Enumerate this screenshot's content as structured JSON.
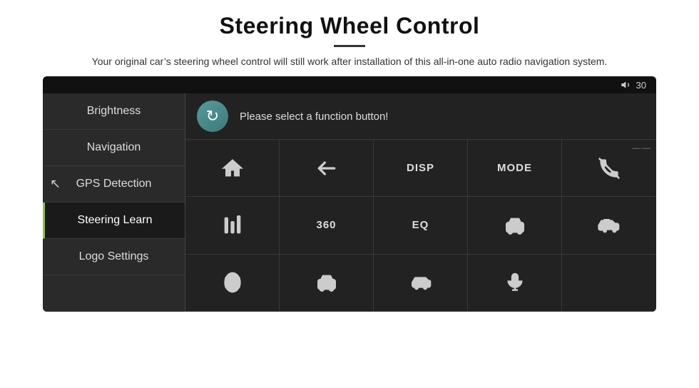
{
  "header": {
    "title": "Steering Wheel Control",
    "subtitle": "Your original car’s steering wheel control will still work after installation of this all-in-one auto radio navigation system."
  },
  "topbar": {
    "volume": "30",
    "volume_label": "30"
  },
  "sidebar": {
    "items": [
      {
        "label": "Brightness",
        "active": false
      },
      {
        "label": "Navigation",
        "active": false
      },
      {
        "label": "GPS Detection",
        "active": false
      },
      {
        "label": "Steering Learn",
        "active": true
      },
      {
        "label": "Logo Settings",
        "active": false
      }
    ]
  },
  "content": {
    "prompt": "Please select a function button!",
    "refresh_tooltip": "Refresh",
    "grid_buttons": [
      {
        "type": "icon",
        "icon": "home",
        "label": ""
      },
      {
        "type": "icon",
        "icon": "back",
        "label": ""
      },
      {
        "type": "text",
        "label": "DISP"
      },
      {
        "type": "text",
        "label": "MODE"
      },
      {
        "type": "icon",
        "icon": "phone-mute",
        "label": ""
      },
      {
        "type": "icon",
        "icon": "equalizer",
        "label": ""
      },
      {
        "type": "text",
        "label": "360"
      },
      {
        "type": "text",
        "label": "EQ"
      },
      {
        "type": "icon",
        "icon": "car-front",
        "label": ""
      },
      {
        "type": "icon",
        "icon": "car-side",
        "label": ""
      },
      {
        "type": "icon",
        "icon": "car-top",
        "label": ""
      },
      {
        "type": "icon",
        "icon": "car-rear",
        "label": ""
      },
      {
        "type": "icon",
        "icon": "car-left",
        "label": ""
      },
      {
        "type": "icon",
        "icon": "mic",
        "label": ""
      },
      {
        "type": "empty",
        "label": ""
      }
    ]
  }
}
